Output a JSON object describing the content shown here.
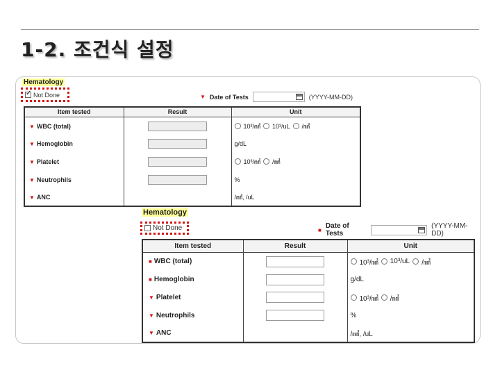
{
  "slide": {
    "title": "1-2. 조건식 설정"
  },
  "panel_checked": {
    "section_label": "Hematology",
    "not_done_label": "Not Done",
    "not_done_checked": true,
    "date_label": "Date of Tests",
    "date_value": "",
    "date_format": "(YYYY-MM-DD)",
    "headers": [
      "Item tested",
      "Result",
      "Unit"
    ],
    "rows": [
      {
        "item": "WBC (total)",
        "units": [
          "10³/㎣",
          "10³/uL",
          "/㎣"
        ]
      },
      {
        "item": "Hemoglobin",
        "units": [],
        "unit_text": "g/dL"
      },
      {
        "item": "Platelet",
        "units": [
          "10³/㎣",
          "/㎣"
        ]
      },
      {
        "item": "Neutrophils",
        "units": [],
        "unit_text": "%"
      },
      {
        "item": "ANC",
        "units": [],
        "unit_text": "/㎣, /uL"
      }
    ]
  },
  "panel_unchecked": {
    "section_label": "Hematology",
    "not_done_label": "Not Done",
    "not_done_checked": false,
    "date_label": "Date of Tests",
    "date_value": "",
    "date_format": "(YYYY-MM-DD)",
    "headers": [
      "Item tested",
      "Result",
      "Unit"
    ],
    "rows": [
      {
        "item": "WBC (total)",
        "units": [
          "10³/㎣",
          "10³/uL",
          "/㎣"
        ]
      },
      {
        "item": "Hemoglobin",
        "units": [],
        "unit_text": "g/dL"
      },
      {
        "item": "Platelet",
        "units": [
          "10³/㎣",
          "/㎣"
        ]
      },
      {
        "item": "Neutrophils",
        "units": [],
        "unit_text": "%"
      },
      {
        "item": "ANC",
        "units": [],
        "unit_text": "/㎣, /uL"
      }
    ]
  },
  "colors": {
    "highlight": "#ffff99",
    "dotted_border": "#d11414",
    "required_marker": "#d11414"
  },
  "icons": {
    "date_picker": "calendar-icon",
    "required": "required-marker-icon"
  }
}
